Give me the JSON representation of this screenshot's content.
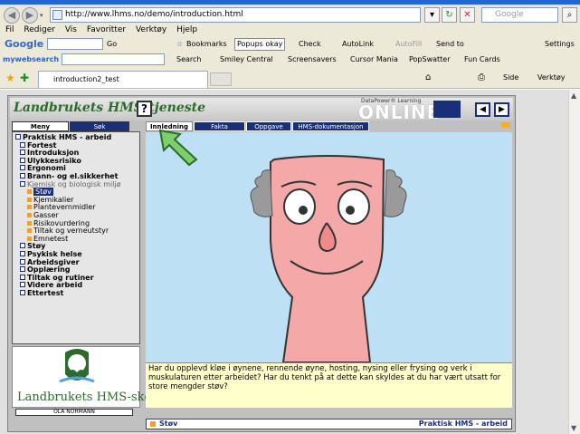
{
  "browser": {
    "url": "http://www.lhms.no/demo/introduction.html",
    "search_placeholder": "Google",
    "menu": [
      "Fil",
      "Rediger",
      "Vis",
      "Favoritter",
      "Verktøy",
      "Hjelp"
    ],
    "google_toolbar": {
      "logo": "Google",
      "go_label": "Go",
      "bookmarks": "Bookmarks",
      "popups": "Popups okay",
      "check": "Check",
      "autolink": "AutoLink",
      "autofill": "AutoFill",
      "send_to": "Send to",
      "settings": "Settings"
    },
    "mywebsearch": {
      "logo": "mywebsearch",
      "search": "Search",
      "smiley": "Smiley Central",
      "screensavers": "Screensavers",
      "cursor_mania": "Cursor Mania",
      "popswatter": "PopSwatter",
      "fun_cards": "Fun Cards"
    },
    "tab_title": "introduction2_test",
    "right_tools": {
      "side": "Side",
      "verktoy": "Verktøy"
    }
  },
  "app": {
    "brand_title": "Landbrukets HMS-tjeneste",
    "help_label": "?",
    "online_text": "ONLINE",
    "online_caption": "DataPower® Learning",
    "left_tabs": [
      "Meny",
      "Søk"
    ],
    "menu_items": [
      {
        "label": "Praktisk HMS - arbeid",
        "level": 0,
        "style": "bold"
      },
      {
        "label": "Fortest",
        "level": 1,
        "style": "bold"
      },
      {
        "label": "Introduksjon",
        "level": 1,
        "style": "bold"
      },
      {
        "label": "Ulykkesrisiko",
        "level": 1,
        "style": "bold"
      },
      {
        "label": "Ergonomi",
        "level": 1,
        "style": "bold"
      },
      {
        "label": "Brann- og el.sikkerhet",
        "level": 1,
        "style": "bold"
      },
      {
        "label": "Kjemisk og biologisk miljø",
        "level": 1,
        "style": "grey"
      },
      {
        "label": "Støv",
        "level": 2,
        "style": "selected"
      },
      {
        "label": "Kjemikalier",
        "level": 2,
        "style": "normal"
      },
      {
        "label": "Plantevernmidler",
        "level": 2,
        "style": "normal"
      },
      {
        "label": "Gasser",
        "level": 2,
        "style": "normal"
      },
      {
        "label": "Risikovurdering",
        "level": 2,
        "style": "normal"
      },
      {
        "label": "Tiltak og verneutstyr",
        "level": 2,
        "style": "normal"
      },
      {
        "label": "Emnetest",
        "level": 2,
        "style": "normal"
      },
      {
        "label": "Støy",
        "level": 1,
        "style": "bold"
      },
      {
        "label": "Psykisk helse",
        "level": 1,
        "style": "bold"
      },
      {
        "label": "Arbeidsgiver",
        "level": 1,
        "style": "bold"
      },
      {
        "label": "Opplæring",
        "level": 1,
        "style": "bold"
      },
      {
        "label": "Tiltak og rutiner",
        "level": 1,
        "style": "bold"
      },
      {
        "label": "Videre arbeid",
        "level": 1,
        "style": "bold"
      },
      {
        "label": "Ettertest",
        "level": 1,
        "style": "bold"
      }
    ],
    "school_name": "Landbrukets HMS-skole",
    "user_name": "OLA NORMANN",
    "content_tabs": [
      "Innledning",
      "Fakta",
      "Oppgave",
      "HMS-dokumentasjon"
    ],
    "active_tab": "Innledning",
    "caption": "Har du opplevd kløe i øynene, rennende øyne, hosting, nysing eller frysing og verk i muskulaturen etter arbeidet? Har du tenkt på at dette kan skyldes at du har vært utsatt for store mengder støv?",
    "status_left": "Støv",
    "status_right": "Praktisk HMS - arbeid"
  }
}
